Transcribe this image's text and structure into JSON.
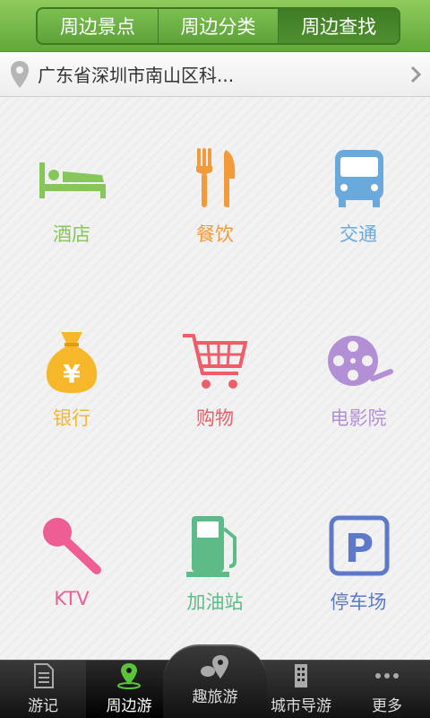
{
  "header": {
    "tabs": [
      "周边景点",
      "周边分类",
      "周边查找"
    ],
    "active_tab": 2
  },
  "location": {
    "text": "广东省深圳市南山区科..."
  },
  "categories": [
    {
      "label": "酒店",
      "icon": "bed-icon",
      "color": "#86c65a"
    },
    {
      "label": "餐饮",
      "icon": "fork-knife-icon",
      "color": "#f39a3b"
    },
    {
      "label": "交通",
      "icon": "bus-icon",
      "color": "#6aa9dc"
    },
    {
      "label": "银行",
      "icon": "money-bag-icon",
      "color": "#f6b72a"
    },
    {
      "label": "购物",
      "icon": "shopping-cart-icon",
      "color": "#ef5d69"
    },
    {
      "label": "电影院",
      "icon": "film-reel-icon",
      "color": "#b38fd6"
    },
    {
      "label": "KTV",
      "icon": "microphone-icon",
      "color": "#ee5e94"
    },
    {
      "label": "加油站",
      "icon": "gas-pump-icon",
      "color": "#5dbb88"
    },
    {
      "label": "停车场",
      "icon": "parking-icon",
      "color": "#5e79c9"
    }
  ],
  "bottom_nav": {
    "items": [
      "游记",
      "周边游",
      "趣旅游",
      "城市导游",
      "更多"
    ],
    "active": 1
  }
}
